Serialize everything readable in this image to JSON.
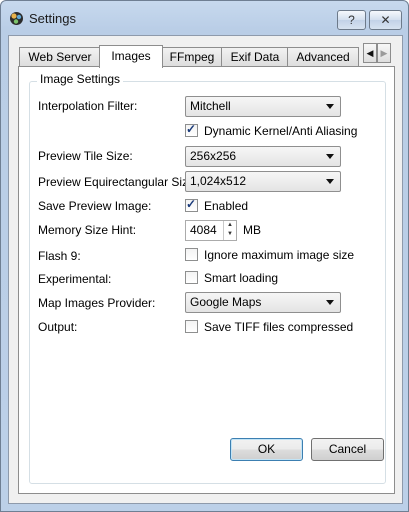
{
  "window": {
    "title": "Settings",
    "help_label": "?",
    "close_label": "✕"
  },
  "tabs": [
    {
      "label": "Web Server"
    },
    {
      "label": "Images",
      "active": true
    },
    {
      "label": "FFmpeg"
    },
    {
      "label": "Exif Data"
    },
    {
      "label": "Advanced"
    }
  ],
  "tab_scroll": {
    "left": "◀",
    "right": "▶"
  },
  "group": {
    "title": "Image Settings"
  },
  "rows": {
    "interpolation": {
      "label": "Interpolation Filter:",
      "value": "Mitchell"
    },
    "dynamic_kernel": {
      "label": "Dynamic Kernel/Anti Aliasing",
      "checked": true
    },
    "preview_tile": {
      "label": "Preview Tile Size:",
      "value": "256x256"
    },
    "preview_equi": {
      "label": "Preview Equirectangular Size:",
      "value": "1,024x512"
    },
    "save_preview": {
      "label": "Save Preview Image:",
      "check_label": "Enabled",
      "checked": true
    },
    "memory": {
      "label": "Memory Size Hint:",
      "value": "4084",
      "unit": "MB"
    },
    "flash": {
      "label": "Flash 9:",
      "check_label": "Ignore maximum image size",
      "checked": false
    },
    "experimental": {
      "label": "Experimental:",
      "check_label": "Smart loading",
      "checked": false
    },
    "map_provider": {
      "label": "Map Images Provider:",
      "value": "Google Maps"
    },
    "output": {
      "label": "Output:",
      "check_label": "Save TIFF files compressed",
      "checked": false
    }
  },
  "buttons": {
    "ok": "OK",
    "cancel": "Cancel"
  },
  "tick_glyph": "✓"
}
